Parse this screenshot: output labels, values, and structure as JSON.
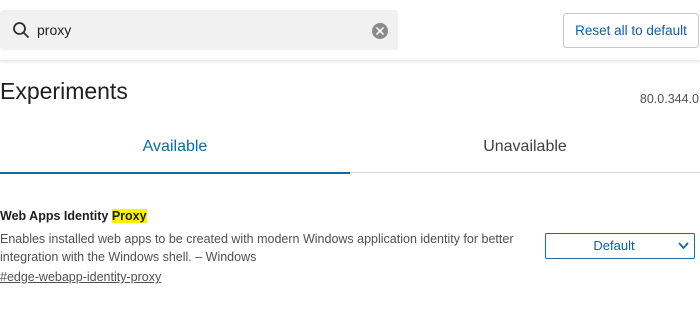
{
  "search": {
    "value": "proxy",
    "icon": "search-icon",
    "clear_icon": "close-icon"
  },
  "toolbar": {
    "reset_label": "Reset all to default"
  },
  "page": {
    "title": "Experiments",
    "version": "80.0.344.0"
  },
  "tabs": [
    {
      "label": "Available",
      "selected": true
    },
    {
      "label": "Unavailable",
      "selected": false
    }
  ],
  "experiment": {
    "title_prefix": "Web Apps Identity ",
    "title_highlight": "Proxy",
    "description": "Enables installed web apps to be created with modern Windows application identity for better integration with the Windows shell. – Windows",
    "link": "#edge-webapp-identity-proxy",
    "select_value": "Default"
  },
  "colors": {
    "accent": "#0f6aa6",
    "highlight": "#fff200",
    "search_bg": "#f1f1f1"
  }
}
